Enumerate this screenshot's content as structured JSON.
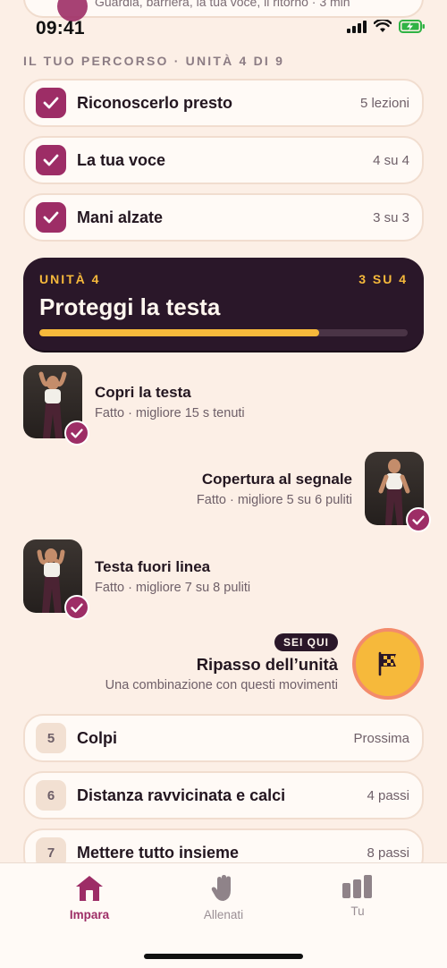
{
  "status_bar": {
    "time": "09:41"
  },
  "peek_card": {
    "subtitle": "Guardia, barriera, la tua voce, il ritorno · 3 min"
  },
  "section_label": "IL TUO PERCORSO · UNITÀ 4 DI 9",
  "completed_units": [
    {
      "title": "Riconoscerlo presto",
      "meta": "5 lezioni"
    },
    {
      "title": "La tua voce",
      "meta": "4 su 4"
    },
    {
      "title": "Mani alzate",
      "meta": "3 su 3"
    }
  ],
  "current_unit": {
    "label": "UNITÀ 4",
    "count": "3 SU 4",
    "title": "Proteggi la testa",
    "progress": 0.76
  },
  "lessons": [
    {
      "title": "Copri la testa",
      "subtitle": "Fatto · migliore 15 s tenuti"
    },
    {
      "title": "Copertura al segnale",
      "subtitle": "Fatto · migliore 5 su 6 puliti"
    },
    {
      "title": "Testa fuori linea",
      "subtitle": "Fatto · migliore 7 su 8 puliti"
    }
  ],
  "review": {
    "badge": "SEI QUI",
    "title": "Ripasso dell’unità",
    "subtitle": "Una combinazione con questi movimenti"
  },
  "upcoming_units": [
    {
      "number": "5",
      "title": "Colpi",
      "meta": "Prossima"
    },
    {
      "number": "6",
      "title": "Distanza ravvicinata e calci",
      "meta": "4 passi"
    },
    {
      "number": "7",
      "title": "Mettere tutto insieme",
      "meta": "8 passi"
    }
  ],
  "tabs": [
    {
      "label": "Impara",
      "icon": "home-icon",
      "active": true
    },
    {
      "label": "Allenati",
      "icon": "hand-icon",
      "active": false
    },
    {
      "label": "Tu",
      "icon": "bar-chart-icon",
      "active": false
    }
  ],
  "colors": {
    "background": "#fcefe6",
    "accent": "#9d2d66",
    "unit_card": "#2a1729",
    "highlight": "#f6b93b"
  }
}
